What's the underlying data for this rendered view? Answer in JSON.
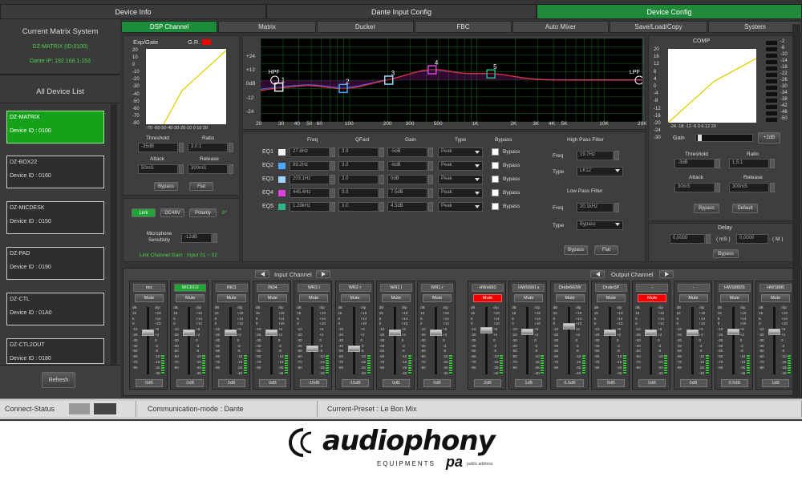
{
  "tabs": [
    "Device Info",
    "Dante Input Config",
    "Device Config"
  ],
  "left": {
    "current_title": "Current Matrix System",
    "current_id": "DZ-MATRIX (ID:0100)",
    "dante_ip": "Dante IP: 192.168.1.153",
    "list_title": "All Device List",
    "refresh": "Refresh",
    "devices": [
      {
        "name": "DZ-MATRIX",
        "id": "Device ID : 0100"
      },
      {
        "name": "DZ-BOX22",
        "id": "Device ID : 0160"
      },
      {
        "name": "DZ-MICDESK",
        "id": "Device ID : 0150"
      },
      {
        "name": "DZ-PAD",
        "id": "Device ID : 0190"
      },
      {
        "name": "DZ-CTL",
        "id": "Device ID : 01A0"
      },
      {
        "name": "DZ-CTL2OUT",
        "id": "Device ID : 0180"
      }
    ]
  },
  "subtabs": [
    "DSP Channel",
    "Matrix",
    "Ducker",
    "FBC",
    "Auto Mixer",
    "Save/Load/Copy",
    "System"
  ],
  "expgate": {
    "title": "Exp/Gate",
    "gr": "G.R.",
    "yticks": [
      "20",
      "10",
      "0",
      "-10",
      "-20",
      "-30",
      "-40",
      "-50",
      "-60",
      "-70",
      "-80"
    ],
    "xticks": "-70 -60-50-40-30-20-10  0  10  20",
    "threshold_label": "Threshold",
    "threshold": "-35dB",
    "ratio_label": "Ratio",
    "ratio": "3.0:1",
    "attack_label": "Attack",
    "attack": "50mS",
    "release_label": "Release",
    "release": "300mS",
    "bypass": "Bypass",
    "flat": "Flat"
  },
  "link": {
    "link": "Link",
    "dc48v": "DC48V",
    "polarity": "Polarity",
    "phase": "0°",
    "mic_sens_label": "Microphone Sensitivity",
    "mic_sens": "-12dB",
    "channel_gain": "Link Channel Gain :   Input 01 ~ 02"
  },
  "eq": {
    "yticks": [
      "+24",
      "+12",
      "0dB",
      "-12",
      "-24"
    ],
    "xticks": [
      "20",
      "30",
      "40",
      "50",
      "60",
      "100",
      "200",
      "300",
      "500",
      "1K",
      "2K",
      "3K",
      "4K",
      "5K",
      "10K",
      "20K"
    ],
    "hpf": "HPF",
    "lpf": "LPF",
    "points": [
      "1",
      "2",
      "3",
      "4",
      "5"
    ],
    "head": {
      "freq": "Freq",
      "q": "QFact",
      "gain": "Gain",
      "type": "Type",
      "bypass": "Bypass"
    },
    "bands": [
      {
        "label": "EQ1",
        "freq": "27.8Hz",
        "q": "3.0",
        "gain": "-5dB",
        "type": "Peak",
        "bypass": "Bypass",
        "color": "#f2f2f2"
      },
      {
        "label": "EQ2",
        "freq": "89.2Hz",
        "q": "3.0",
        "gain": "-6dB",
        "type": "Peak",
        "bypass": "Bypass",
        "color": "#4aa8ff"
      },
      {
        "label": "EQ3",
        "freq": "203.1Hz",
        "q": "3.0",
        "gain": "0dB",
        "type": "Peak",
        "bypass": "Bypass",
        "color": "#9fd6ff"
      },
      {
        "label": "EQ4",
        "freq": "445.4Hz",
        "q": "3.0",
        "gain": "7.5dB",
        "type": "Peak",
        "bypass": "Bypass",
        "color": "#e040e0"
      },
      {
        "label": "EQ5",
        "freq": "1.29kHz",
        "q": "3.0",
        "gain": "4.5dB",
        "type": "Peak",
        "bypass": "Bypass",
        "color": "#2fb58a"
      }
    ],
    "hpf_title": "High Pass Filter",
    "hpf_freq_label": "Freq",
    "hpf_freq": "19.7Hz",
    "hpf_type_label": "Type",
    "hpf_type": "LK12",
    "lpf_title": "Low Pass Filter",
    "lpf_freq_label": "Freq",
    "lpf_freq": "20.1kHz",
    "lpf_type_label": "Type",
    "lpf_type": "Bypass",
    "bypass": "Bypass",
    "flat": "Flat"
  },
  "comp": {
    "title": "COMP",
    "yticks": [
      "20",
      "16",
      "12",
      "8",
      "4",
      "0",
      "-4",
      "-8",
      "-12",
      "-16",
      "-20",
      "-24",
      "-30"
    ],
    "xticks": "-24 -18  -12  -6   0   6  12 20",
    "gain_label": "Gain",
    "gain": "+2dB",
    "threshold_label": "Threshold",
    "threshold": "-3dB",
    "ratio_label": "Ratio",
    "ratio": "1.5:1",
    "attack_label": "Attack",
    "attack": "30mS",
    "release_label": "Release",
    "release": "300mS",
    "bypass": "Bypass",
    "default": "Default",
    "meter": [
      "-2",
      "-6",
      "-10",
      "-14",
      "-18",
      "-22",
      "-26",
      "-30",
      "-34",
      "-38",
      "-42",
      "-46",
      "-50"
    ]
  },
  "delay": {
    "title": "Delay",
    "ms_val": "0,0000",
    "ms_unit": "( mS )",
    "m_val": "0,0000",
    "m_unit": "( M )",
    "bypass": "Bypass"
  },
  "mixer": {
    "input_label": "Input Channel",
    "output_label": "Output Channel",
    "mute": "Mute",
    "db": "dB",
    "clip": "clip",
    "ticks_left": [
      "15",
      "5",
      "0",
      "-10",
      "-20",
      "-30",
      "-40",
      "-50",
      "-60",
      "-70",
      "-80"
    ],
    "ticks_right": [
      "+19",
      "+14",
      "+10",
      "+6",
      "+2",
      "0",
      "-3",
      "-6",
      "-10",
      "-15",
      "-25",
      "-40"
    ],
    "channels": [
      {
        "name": "mic",
        "gain": "0dB",
        "lvl": 0.62,
        "muted": false,
        "sel": false
      },
      {
        "name": "MICRO2",
        "gain": "0dB",
        "lvl": 0.62,
        "muted": false,
        "sel": true
      },
      {
        "name": "IN03",
        "gain": "0dB",
        "lvl": 0.62,
        "muted": false,
        "sel": false
      },
      {
        "name": "IN04",
        "gain": "0dB",
        "lvl": 0.62,
        "muted": false,
        "sel": false
      },
      {
        "name": "WR2 l",
        "gain": "-15dB",
        "lvl": 0.38,
        "muted": false,
        "sel": false
      },
      {
        "name": "WR2 r",
        "gain": "-15dB",
        "lvl": 0.38,
        "muted": false,
        "sel": false
      },
      {
        "name": "WR1 l",
        "gain": "0dB",
        "lvl": 0.62,
        "muted": false,
        "sel": false
      },
      {
        "name": "WR1 r",
        "gain": "0dB",
        "lvl": 0.62,
        "muted": false,
        "sel": false
      },
      {
        "name": "HWs660",
        "gain": "2dB",
        "lvl": 0.65,
        "muted": true,
        "sel": false
      },
      {
        "name": "HWS660 s",
        "gain": "1dB",
        "lvl": 0.63,
        "muted": false,
        "sel": false
      },
      {
        "name": "Onde660W",
        "gain": "6.5dB",
        "lvl": 0.72,
        "muted": false,
        "sel": false
      },
      {
        "name": "OndeSP",
        "gain": "0dB",
        "lvl": 0.62,
        "muted": false,
        "sel": false
      },
      {
        "name": "-",
        "gain": "0dB",
        "lvl": 0.62,
        "muted": true,
        "sel": false
      },
      {
        "name": "-",
        "gain": "0dB",
        "lvl": 0.62,
        "muted": false,
        "sel": false
      },
      {
        "name": "HWS880S",
        "gain": "0.5dB",
        "lvl": 0.63,
        "muted": false,
        "sel": false
      },
      {
        "name": "HWS880",
        "gain": "1dB",
        "lvl": 0.63,
        "muted": false,
        "sel": false
      }
    ]
  },
  "status": {
    "connect": "Connect-Status",
    "mode": "Communication-mode : Dante",
    "preset": "Current-Preset : Le Bon Mix"
  },
  "logo": {
    "brand": "audiophony",
    "sub": "EQUIPMENTS",
    "pa": "pa",
    "tag": "public address"
  }
}
